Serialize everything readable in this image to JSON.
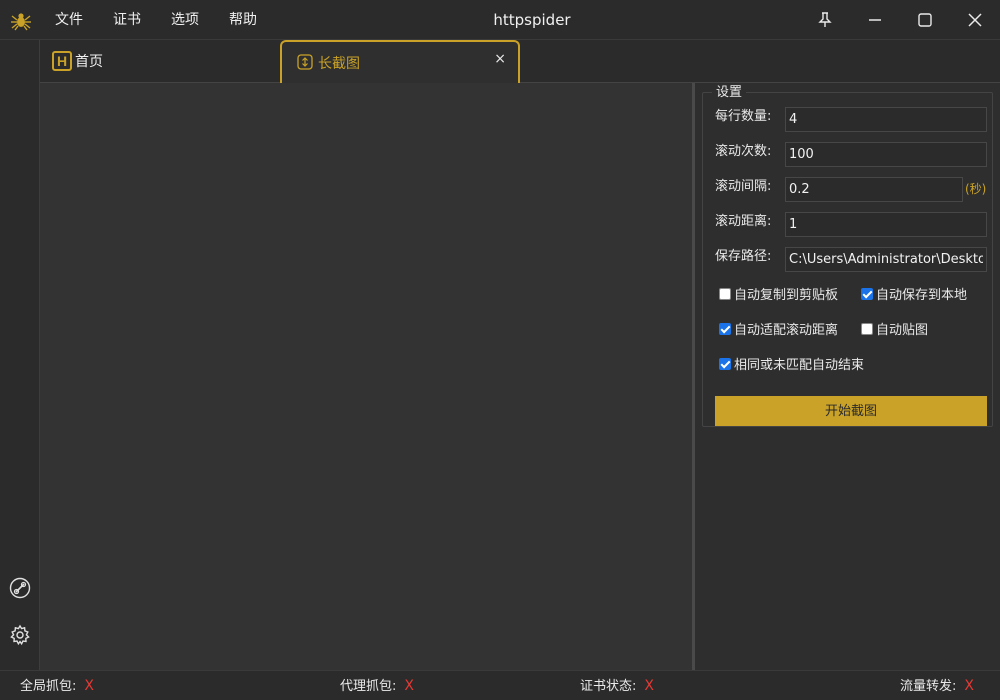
{
  "app": {
    "title": "httpspider",
    "logo_icon": "spider-icon"
  },
  "menu": [
    {
      "label": "文件"
    },
    {
      "label": "证书"
    },
    {
      "label": "选项"
    },
    {
      "label": "帮助"
    }
  ],
  "window_controls": {
    "pin_icon": "pin-icon",
    "minimize_icon": "minimize-icon",
    "maximize_icon": "maximize-icon",
    "close_icon": "close-icon"
  },
  "sidebar": {
    "icons": [
      "link-icon",
      "gear-icon"
    ]
  },
  "tabs": {
    "home": {
      "label": "首页",
      "icon_letter": "H"
    },
    "active": {
      "label": "长截图",
      "close": "×",
      "icon": "scroll-capture-icon"
    }
  },
  "settings": {
    "group_title": "设置",
    "per_row": {
      "label": "每行数量:",
      "value": "4"
    },
    "scroll_count": {
      "label": "滚动次数:",
      "value": "100"
    },
    "scroll_interval": {
      "label": "滚动间隔:",
      "value": "0.2",
      "unit": "(秒)"
    },
    "scroll_distance": {
      "label": "滚动距离:",
      "value": "1"
    },
    "save_path": {
      "label": "保存路径:",
      "value": "C:\\Users\\Administrator\\Desktop\\h"
    },
    "checkboxes": [
      {
        "label": "自动复制到剪贴板",
        "checked": false
      },
      {
        "label": "自动保存到本地",
        "checked": true
      },
      {
        "label": "自动适配滚动距离",
        "checked": true
      },
      {
        "label": "自动贴图",
        "checked": false
      },
      {
        "label": "相同或未匹配自动结束",
        "checked": true
      }
    ],
    "start_button": "开始截图"
  },
  "status_bar": [
    {
      "label": "全局抓包:",
      "value": "X"
    },
    {
      "label": "代理抓包:",
      "value": "X"
    },
    {
      "label": "证书状态:",
      "value": "X"
    },
    {
      "label": "流量转发:",
      "value": "X"
    }
  ],
  "colors": {
    "accent": "#c9a227",
    "error": "#e53935",
    "checkbox": "#1a73e8"
  }
}
